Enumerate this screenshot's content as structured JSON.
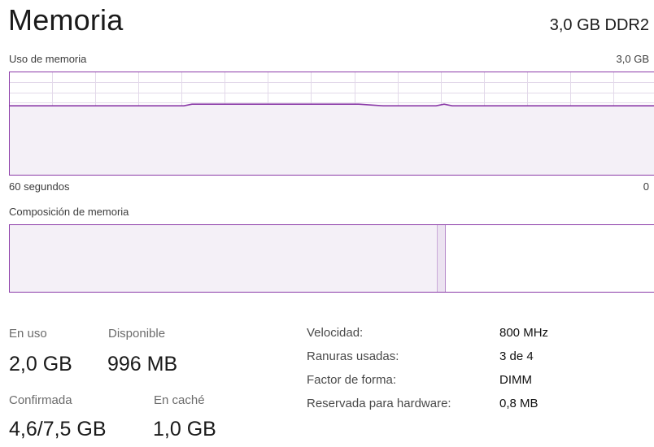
{
  "header": {
    "title": "Memoria",
    "memory_type": "3,0 GB DDR2"
  },
  "usage_graph": {
    "label": "Uso de memoria",
    "max_label": "3,0 GB",
    "time_label": "60 segundos",
    "zero_label": "0",
    "level_fraction": 0.67
  },
  "composition": {
    "label": "Composición de memoria",
    "in_use_fraction": 0.663,
    "modified_fraction": 0.013
  },
  "stats": {
    "in_use_label": "En uso",
    "in_use_value": "2,0 GB",
    "available_label": "Disponible",
    "available_value": "996 MB",
    "committed_label": "Confirmada",
    "committed_value": "4,6/7,5 GB",
    "cached_label": "En caché",
    "cached_value": "1,0 GB"
  },
  "info": [
    {
      "key": "Velocidad:",
      "value": "800 MHz"
    },
    {
      "key": "Ranuras usadas:",
      "value": "3 de 4"
    },
    {
      "key": "Factor de forma:",
      "value": "DIMM"
    },
    {
      "key": "Reservada para hardware:",
      "value": "0,8 MB"
    }
  ],
  "colors": {
    "accent": "#8b3aa8",
    "fill": "#f4f0f7",
    "grid": "#e3d9ea"
  }
}
